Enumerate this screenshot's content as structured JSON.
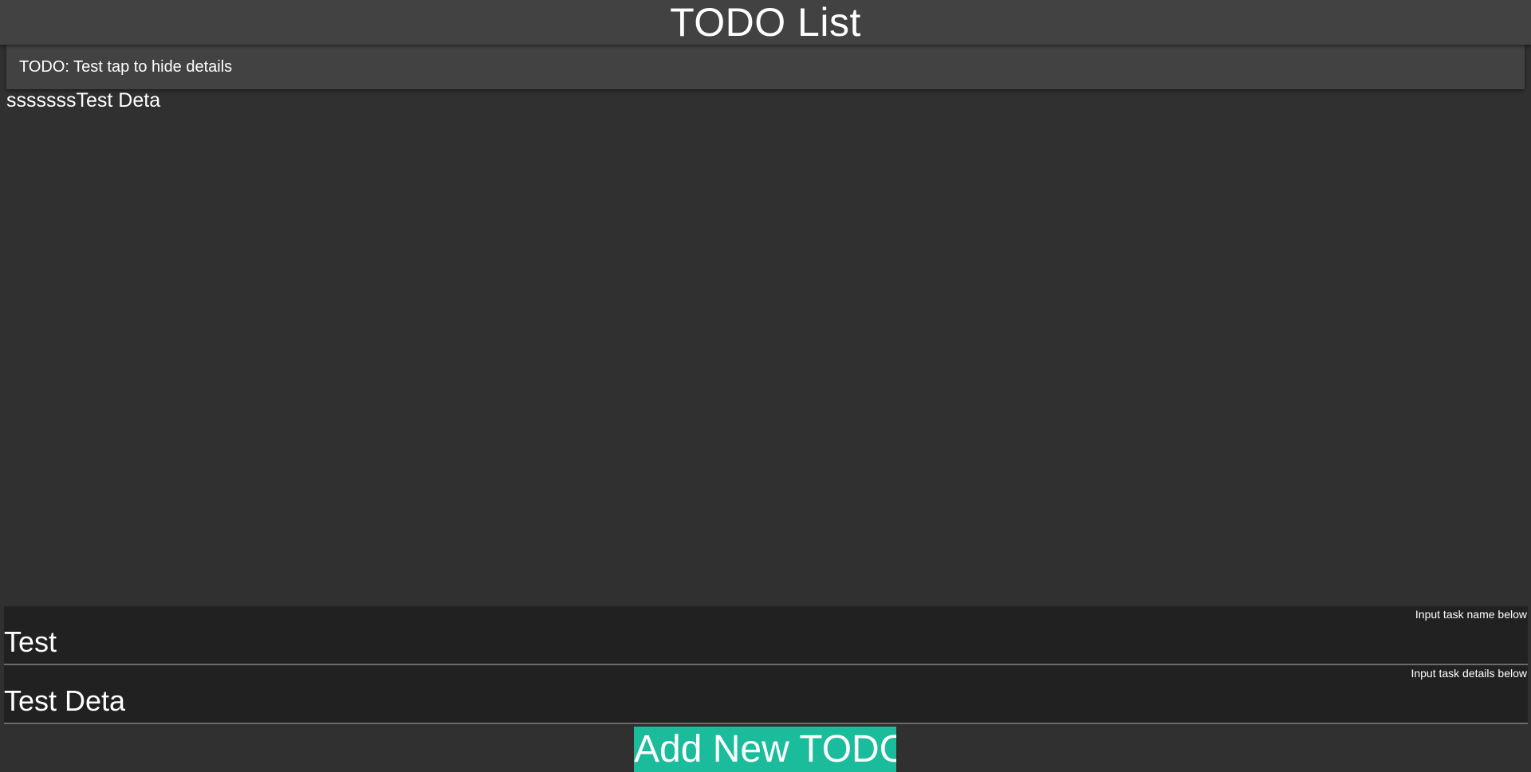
{
  "app_bar": {
    "title": "TODO List"
  },
  "todo_list": {
    "items": [
      {
        "label": "TODO: Test tap to hide details",
        "details": "sssssssTest Deta"
      }
    ]
  },
  "form": {
    "name_hint": "Input task name below",
    "name_value": "Test",
    "details_hint": "Input task details below",
    "details_value": "Test Deta",
    "add_button_label": "Add New TODO"
  },
  "colors": {
    "background": "#303030",
    "app_bar": "#424242",
    "card": "#424242",
    "input_background": "#212121",
    "accent": "#1abc9c",
    "text": "#ffffff"
  }
}
